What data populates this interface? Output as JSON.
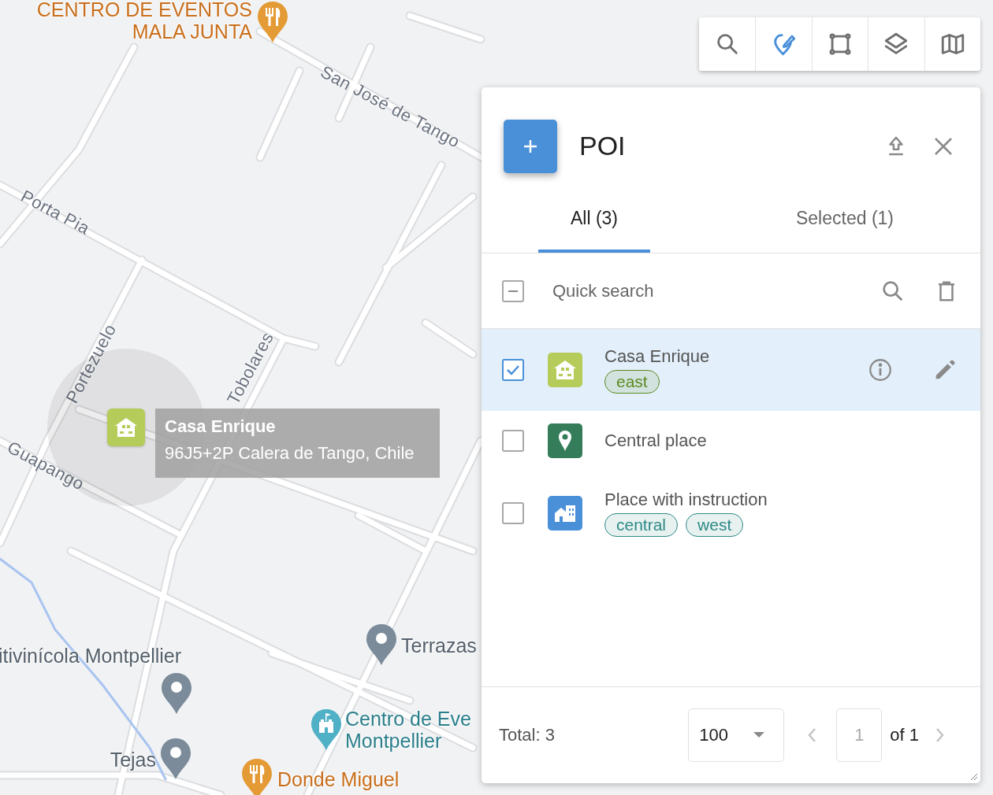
{
  "map": {
    "streets": [
      "San José de Tango",
      "Porta Pia",
      "Portezuelo",
      "Guapango",
      "Tobolares"
    ],
    "places": [
      {
        "kind": "restaurant",
        "lines": [
          "CENTRO DE EVENTOS",
          "MALA JUNTA"
        ]
      },
      {
        "kind": "pin",
        "lines": [
          "Terrazas"
        ]
      },
      {
        "kind": "pin",
        "lines": [
          "itivinícola Montpellier"
        ]
      },
      {
        "kind": "pin",
        "lines": [
          "Tejas"
        ]
      },
      {
        "kind": "landmark",
        "lines": [
          "Centro de Eve",
          "Montpellier"
        ]
      },
      {
        "kind": "restaurant",
        "lines": [
          "Donde Miguel"
        ]
      }
    ],
    "marker": {
      "title": "Casa Enrique",
      "address": "96J5+2P Calera de Tango, Chile",
      "color": "#b5cc5a"
    }
  },
  "toolbar": {
    "buttons": [
      {
        "kind": "search",
        "selected": false
      },
      {
        "kind": "poi",
        "selected": true
      },
      {
        "kind": "area",
        "selected": false
      },
      {
        "kind": "layers",
        "selected": false
      },
      {
        "kind": "map",
        "selected": false
      }
    ]
  },
  "panel": {
    "title": "POI",
    "tabs": [
      {
        "label": "All (3)",
        "selected": true
      },
      {
        "label": "Selected (1)",
        "selected": false
      }
    ],
    "search": {
      "placeholder": "Quick search",
      "select_all": {
        "indeterminate": true
      }
    },
    "items": [
      {
        "name": "Casa Enrique",
        "kind": "house",
        "color": "#b5cc5a",
        "checked": true,
        "hovered": true,
        "tags": [
          {
            "label": "east",
            "color": "#5b8a1e"
          }
        ]
      },
      {
        "name": "Central place",
        "kind": "pin",
        "color": "#357d5a",
        "checked": false,
        "hovered": false
      },
      {
        "name": "Place with instruction",
        "kind": "building",
        "color": "#4a90d9",
        "checked": false,
        "hovered": false,
        "tags": [
          {
            "label": "central",
            "color": "#2e8a86"
          },
          {
            "label": "west",
            "color": "#2e8a86"
          }
        ]
      }
    ],
    "footer": {
      "total": "Total: 3",
      "page_size": "100",
      "page": "1",
      "of": "of 1"
    }
  }
}
